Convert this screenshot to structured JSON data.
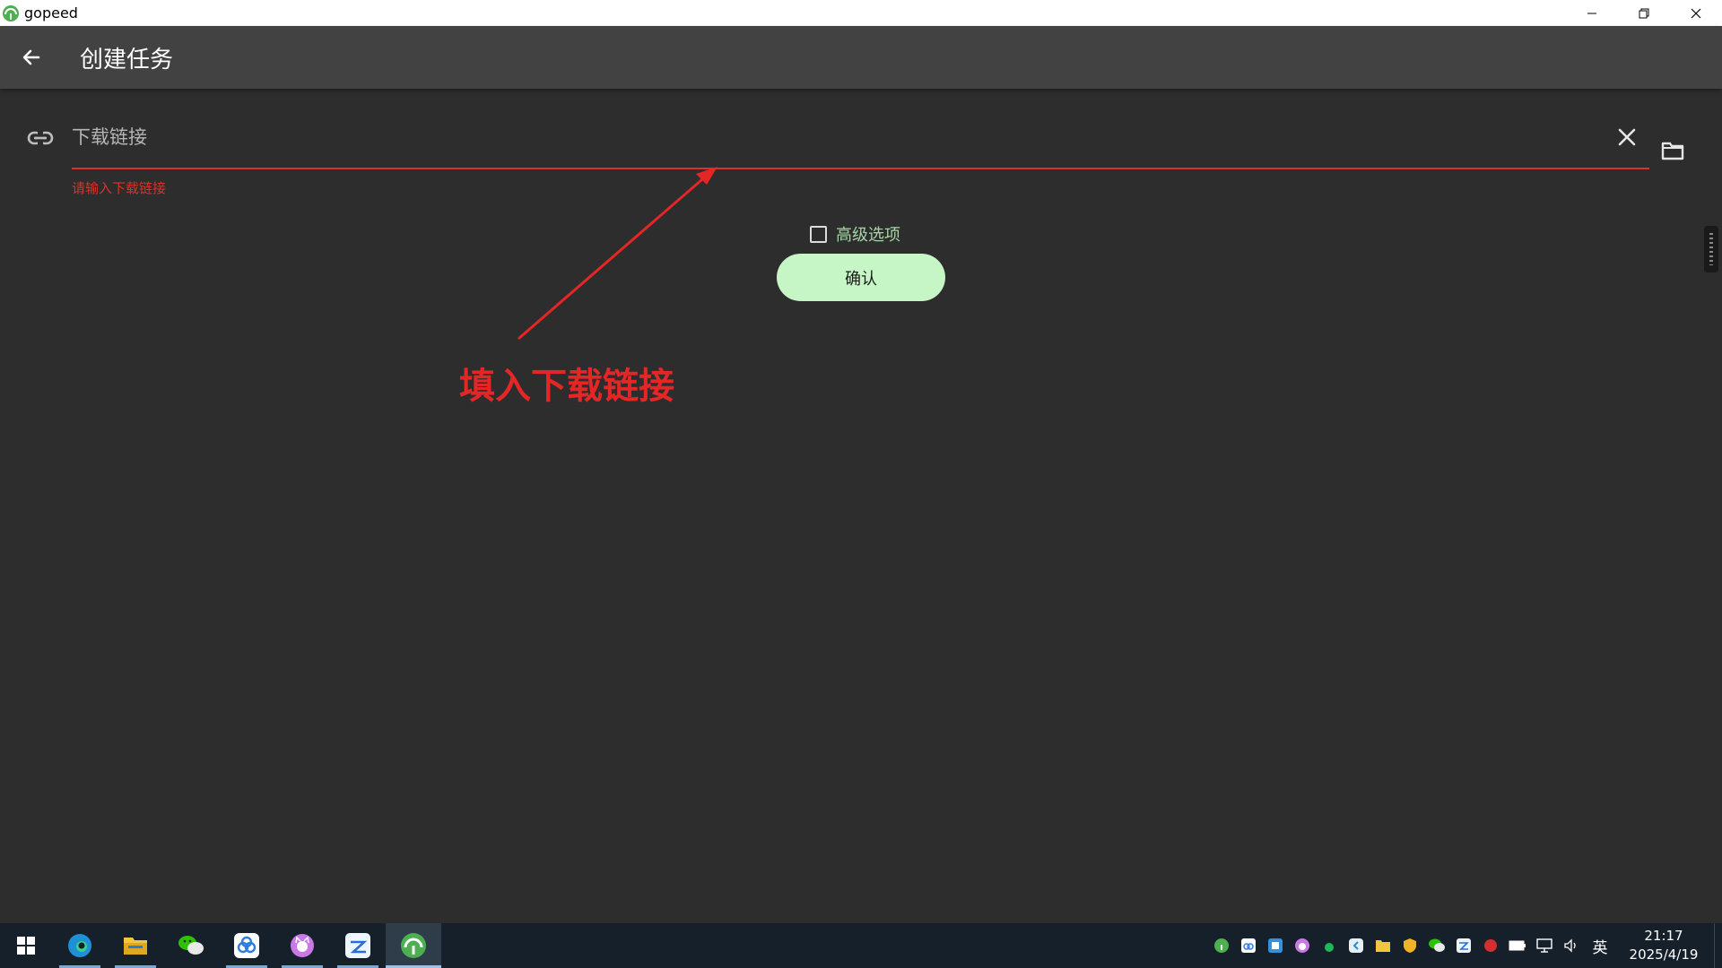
{
  "window": {
    "app_name": "gopeed",
    "controls": [
      "minimize",
      "restore",
      "close"
    ]
  },
  "appbar": {
    "title": "创建任务",
    "back_icon": "arrow-left-icon"
  },
  "form": {
    "url_placeholder": "下载链接",
    "url_value": "",
    "error_text": "请输入下载链接",
    "advanced_label": "高级选项",
    "advanced_checked": false,
    "confirm_label": "确认"
  },
  "annotation": {
    "text": "填入下载链接",
    "color": "#e52626"
  },
  "colors": {
    "background": "#2d2d2d",
    "appbar": "#424242",
    "error": "#d9322b",
    "accent_green": "#a5d6a7",
    "button_bg": "#c6f5c6"
  },
  "taskbar": {
    "apps": [
      {
        "name": "edge-browser-icon",
        "running": true
      },
      {
        "name": "file-explorer-icon",
        "running": true
      },
      {
        "name": "wechat-icon",
        "running": false
      },
      {
        "name": "baidu-netdisk-icon",
        "running": true
      },
      {
        "name": "cat-app-icon",
        "running": true
      },
      {
        "name": "cloud-app-icon",
        "running": true
      },
      {
        "name": "gopeed-icon",
        "running": true,
        "active": true
      }
    ],
    "tray_icons": [
      "gopeed-tray-icon",
      "netdisk-tray-icon",
      "app-tray-icon",
      "cat-tray-icon",
      "green-dot-tray-icon",
      "arrow-tray-icon",
      "folder-tray-icon",
      "shield-tray-icon",
      "wechat-tray-icon",
      "cloud-tray-icon",
      "red-tray-icon",
      "battery-icon",
      "network-icon",
      "volume-icon"
    ],
    "ime": "英",
    "time": "21:17",
    "date": "2025/4/19"
  }
}
